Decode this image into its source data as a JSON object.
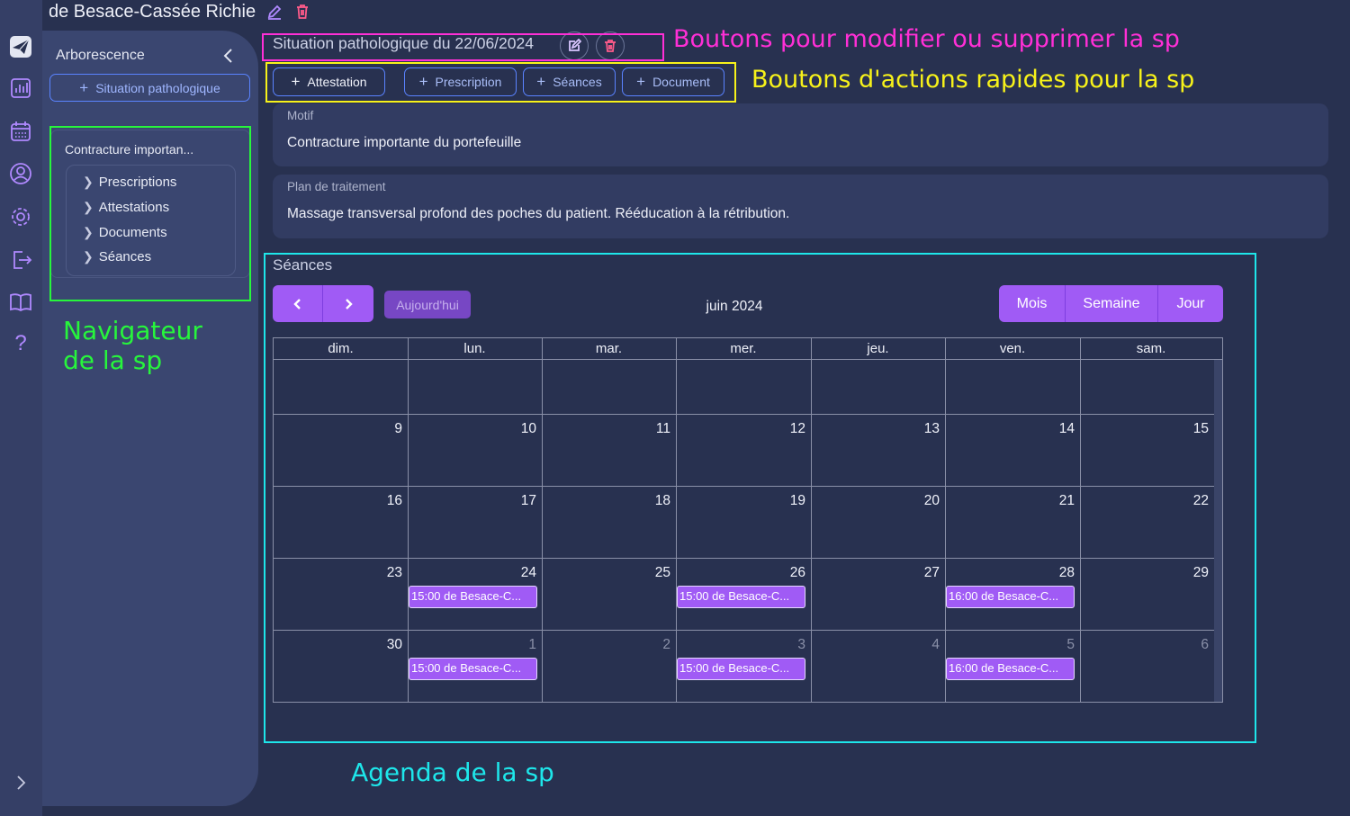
{
  "patient": {
    "name": "de Besace-Cassée Richie"
  },
  "sidebar": {
    "title": "Arborescence",
    "add_label": "Situation pathologique",
    "tree": {
      "title": "Contracture importan...",
      "items": [
        {
          "label": "Prescriptions"
        },
        {
          "label": "Attestations"
        },
        {
          "label": "Documents"
        },
        {
          "label": "Séances"
        }
      ]
    }
  },
  "sp": {
    "title": "Situation pathologique du 22/06/2024",
    "quick_actions": [
      {
        "label": "Attestation"
      },
      {
        "label": "Prescription"
      },
      {
        "label": "Séances"
      },
      {
        "label": "Document"
      }
    ],
    "motif": {
      "label": "Motif",
      "value": "Contracture importante du portefeuille"
    },
    "plan": {
      "label": "Plan de traitement",
      "value": "Massage transversal profond des poches du patient. Rééducation à la rétribution."
    }
  },
  "calendar": {
    "section_title": "Séances",
    "today_label": "Aujourd'hui",
    "title": "juin 2024",
    "views": [
      {
        "label": "Mois"
      },
      {
        "label": "Semaine"
      },
      {
        "label": "Jour"
      }
    ],
    "weekdays": [
      "dim.",
      "lun.",
      "mar.",
      "mer.",
      "jeu.",
      "ven.",
      "sam."
    ],
    "weeks": [
      [
        "",
        "",
        "",
        "",
        "",
        "",
        ""
      ],
      [
        "9",
        "10",
        "11",
        "12",
        "13",
        "14",
        "15"
      ],
      [
        "16",
        "17",
        "18",
        "19",
        "20",
        "21",
        "22"
      ],
      [
        "23",
        "24",
        "25",
        "26",
        "27",
        "28",
        "29"
      ],
      [
        "30",
        "1",
        "2",
        "3",
        "4",
        "5",
        "6"
      ]
    ],
    "events": [
      {
        "week": 3,
        "day": 1,
        "label": "15:00 de Besace-C..."
      },
      {
        "week": 3,
        "day": 3,
        "label": "15:00 de Besace-C..."
      },
      {
        "week": 3,
        "day": 5,
        "label": "16:00 de Besace-C..."
      },
      {
        "week": 4,
        "day": 1,
        "label": "15:00 de Besace-C..."
      },
      {
        "week": 4,
        "day": 3,
        "label": "15:00 de Besace-C..."
      },
      {
        "week": 4,
        "day": 5,
        "label": "16:00 de Besace-C..."
      }
    ]
  },
  "annotations": {
    "header_buttons": "Boutons pour modifier ou supprimer la sp",
    "quick_actions": "Boutons d'actions rapides pour la sp",
    "navigator_line1": "Navigateur",
    "navigator_line2": "de la sp",
    "agenda": "Agenda de la sp"
  },
  "colors": {
    "background": "#283150",
    "accent": "#a05bf5",
    "anno_magenta": "#ff2fd6",
    "anno_yellow": "#f7f21a",
    "anno_green": "#27f53c",
    "anno_cyan": "#1ee6ea"
  }
}
